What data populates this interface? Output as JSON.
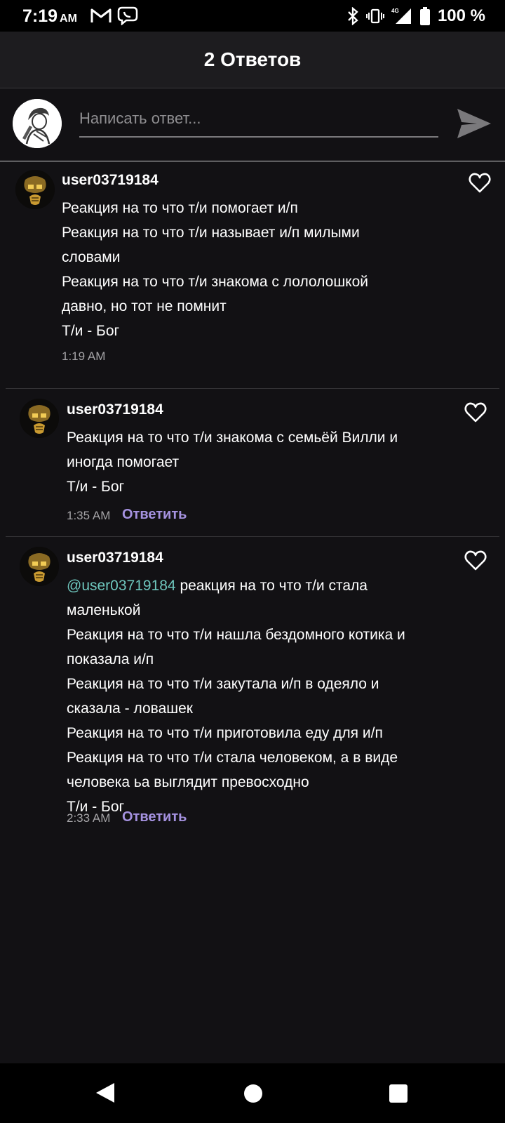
{
  "status_bar": {
    "time": "7:19",
    "ampm": "AM",
    "network": "4G",
    "battery": "100 %"
  },
  "header": {
    "title": "2 Ответов"
  },
  "composer": {
    "placeholder": "Написать ответ..."
  },
  "comments": [
    {
      "username": "user03719184",
      "lines": [
        "Реакция на то что т/и помогает и/п",
        "Реакция на то что т/и называет и/п милыми словами",
        "Реакция на то что т/и знакома с лололошкой давно, но тот не помнит",
        "Т/и - Бог"
      ],
      "time": "1:19 AM"
    },
    {
      "username": "user03719184",
      "lines": [
        "Реакция на то что т/и знакома с семьёй Вилли и иногда помогает",
        "Т/и - Бог"
      ],
      "time": "1:35 AM",
      "reply_label": "Ответить"
    },
    {
      "username": "user03719184",
      "mention": "@user03719184",
      "first_line": " реакция на то что т/и стала маленькой",
      "lines": [
        "Реакция на то что т/и нашла бездомного котика и показала и/п",
        "Реакция на то что т/и закутала и/п в одеяло и сказала - ловашек",
        "Реакция на то что т/и приготовила еду для и/п",
        "Реакция на то что т/и стала человеком, а в виде человека ьа выглядит превосходно",
        "Т/и - Бог"
      ],
      "time": "2:33 AM",
      "reply_label": "Ответить"
    }
  ],
  "colors": {
    "background": "#121114",
    "header": "#1d1c1f",
    "reply_link": "#a592e0",
    "mention": "#6ec6bd"
  },
  "icons": [
    "gmail-icon",
    "viber-icon",
    "bluetooth-icon",
    "vibrate-icon",
    "signal-icon",
    "battery-icon",
    "send-icon",
    "heart-icon",
    "back-icon",
    "home-icon",
    "recents-icon"
  ]
}
